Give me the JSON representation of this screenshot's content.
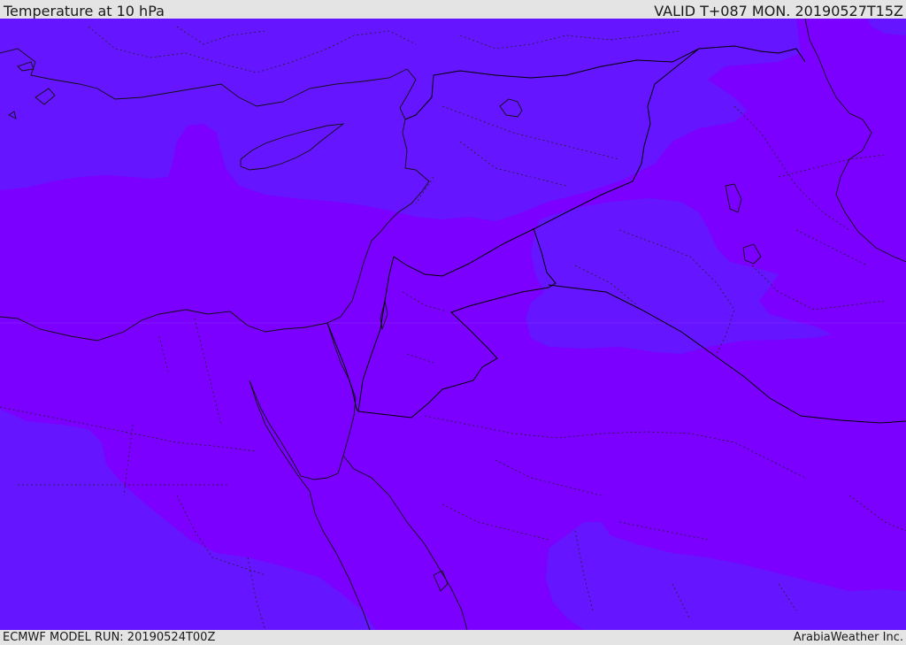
{
  "header": {
    "title": "Temperature at 10 hPa",
    "valid": "VALID T+087 MON. 20190527T15Z"
  },
  "footer": {
    "model_run": "ECMWF MODEL RUN: 20190524T00Z",
    "credit": "ArabiaWeather Inc."
  },
  "map": {
    "colors": {
      "warm_band": "#7b00ff",
      "cool_band": "#6515ff",
      "border": "#000000"
    }
  }
}
